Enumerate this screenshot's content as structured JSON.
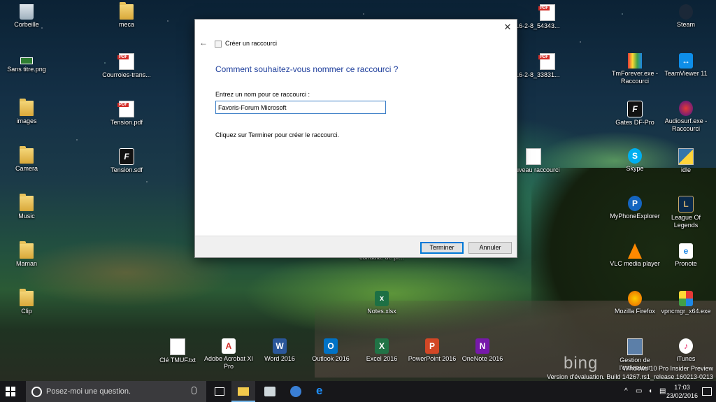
{
  "desktop": {
    "icons": [
      {
        "label": "Corbeille",
        "icon": "recycle-bin-icon"
      },
      {
        "label": "meca",
        "icon": "folder-icon"
      },
      {
        "label": "16-2-8_54343...",
        "icon": "pdf-file-icon"
      },
      {
        "label": "Steam",
        "icon": "steam-icon"
      },
      {
        "label": "Sans titre.png",
        "icon": "image-file-icon"
      },
      {
        "label": "Courroies-trans...",
        "icon": "pdf-file-icon"
      },
      {
        "label": "16-2-8_33831...",
        "icon": "pdf-file-icon"
      },
      {
        "label": "TmForever.exe - Raccourci",
        "icon": "tmforever-icon"
      },
      {
        "label": "TeamViewer 11",
        "icon": "teamviewer-icon"
      },
      {
        "label": "images",
        "icon": "folder-icon"
      },
      {
        "label": "Tension.pdf",
        "icon": "pdf-file-icon"
      },
      {
        "label": "Gates DF-Pro",
        "icon": "gates-df-pro-icon"
      },
      {
        "label": "Audiosurf.exe - Raccourci",
        "icon": "audiosurf-icon"
      },
      {
        "label": "Camera",
        "icon": "folder-icon"
      },
      {
        "label": "Tension.sdf",
        "icon": "sdf-file-icon"
      },
      {
        "label": "Nouveau raccourci",
        "icon": "shortcut-file-icon"
      },
      {
        "label": "Skype",
        "icon": "skype-icon"
      },
      {
        "label": "idle",
        "icon": "python-idle-icon"
      },
      {
        "label": "Music",
        "icon": "folder-icon"
      },
      {
        "label": "MyPhoneExplorer",
        "icon": "myphoneexplorer-icon"
      },
      {
        "label": "League Of Legends",
        "icon": "league-of-legends-icon"
      },
      {
        "label": "Maman",
        "icon": "folder-icon"
      },
      {
        "label": "Copie de Grille conduite de pr...",
        "icon": "pdf-file-icon"
      },
      {
        "label": "VLC media player",
        "icon": "vlc-icon"
      },
      {
        "label": "Pronote",
        "icon": "pronote-icon"
      },
      {
        "label": "Clip",
        "icon": "folder-icon"
      },
      {
        "label": "Notes.xlsx",
        "icon": "excel-file-icon"
      },
      {
        "label": "Mozilla Firefox",
        "icon": "firefox-icon"
      },
      {
        "label": "vpncmgr_x64.exe",
        "icon": "vpn-manager-icon"
      },
      {
        "label": "Clé TMUF.txt",
        "icon": "text-file-icon"
      },
      {
        "label": "Adobe Acrobat XI Pro",
        "icon": "acrobat-icon"
      },
      {
        "label": "Word 2016",
        "icon": "word-icon"
      },
      {
        "label": "Outlook 2016",
        "icon": "outlook-icon"
      },
      {
        "label": "Excel 2016",
        "icon": "excel-icon"
      },
      {
        "label": "PowerPoint 2016",
        "icon": "powerpoint-icon"
      },
      {
        "label": "OneNote 2016",
        "icon": "onenote-icon"
      },
      {
        "label": "Gestion de l'ordinateur",
        "icon": "computer-management-icon"
      },
      {
        "label": "iTunes",
        "icon": "itunes-icon"
      }
    ],
    "watermark": {
      "logo": "bing",
      "line1": "Windows 10 Pro Insider Preview",
      "line2": "Version d'évaluation. Build 14267.rs1_release.160213-0213"
    }
  },
  "dialog": {
    "window_title": "Créer un raccourci",
    "heading": "Comment souhaitez-vous nommer ce raccourci ?",
    "name_label": "Entrez un nom pour ce raccourci :",
    "name_value": "Favoris-Forum Microsoft",
    "hint": "Cliquez sur Terminer pour créer le raccourci.",
    "finish_label": "Terminer",
    "cancel_label": "Annuler",
    "close_glyph": "✕",
    "back_glyph": "←"
  },
  "taskbar": {
    "search_placeholder": "Posez-moi une question.",
    "time": "17:03",
    "date": "23/02/2016",
    "accent": "#76b9ed"
  }
}
